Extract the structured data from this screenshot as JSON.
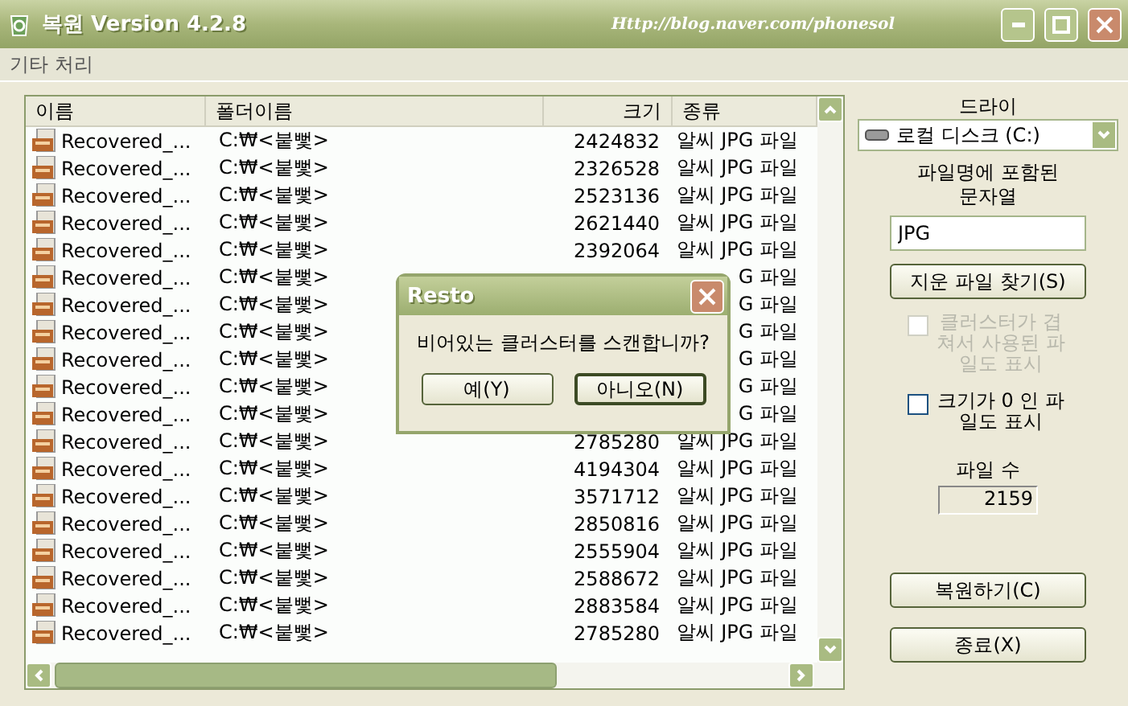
{
  "window": {
    "title": "복원 Version 4.2.8",
    "url": "Http://blog.naver.com/phonesol"
  },
  "menu": [
    "기타 처리"
  ],
  "table": {
    "columns": [
      "이름",
      "폴더이름",
      "크기",
      "종류"
    ],
    "rows": [
      {
        "name": "Recovered_...",
        "folder": "C:₩<붙뻧>",
        "size": "2424832",
        "type": "알씨 JPG 파일"
      },
      {
        "name": "Recovered_...",
        "folder": "C:₩<붙뻧>",
        "size": "2326528",
        "type": "알씨 JPG 파일"
      },
      {
        "name": "Recovered_...",
        "folder": "C:₩<붙뻧>",
        "size": "2523136",
        "type": "알씨 JPG 파일"
      },
      {
        "name": "Recovered_...",
        "folder": "C:₩<붙뻧>",
        "size": "2621440",
        "type": "알씨 JPG 파일"
      },
      {
        "name": "Recovered_...",
        "folder": "C:₩<붙뻧>",
        "size": "2392064",
        "type": "알씨 JPG 파일"
      },
      {
        "name": "Recovered_...",
        "folder": "C:₩<붙뻧>",
        "type": "G 파일"
      },
      {
        "name": "Recovered_...",
        "folder": "C:₩<붙뻧>",
        "type": "G 파일"
      },
      {
        "name": "Recovered_...",
        "folder": "C:₩<붙뻧>",
        "type": "G 파일"
      },
      {
        "name": "Recovered_...",
        "folder": "C:₩<붙뻧>",
        "type": "G 파일"
      },
      {
        "name": "Recovered_...",
        "folder": "C:₩<붙뻧>",
        "type": "G 파일"
      },
      {
        "name": "Recovered_...",
        "folder": "C:₩<붙뻧>",
        "type": "G 파일"
      },
      {
        "name": "Recovered_...",
        "folder": "C:₩<붙뻧>",
        "size": "2785280",
        "type": "알씨 JPG 파일"
      },
      {
        "name": "Recovered_...",
        "folder": "C:₩<붙뻧>",
        "size": "4194304",
        "type": "알씨 JPG 파일"
      },
      {
        "name": "Recovered_...",
        "folder": "C:₩<붙뻧>",
        "size": "3571712",
        "type": "알씨 JPG 파일"
      },
      {
        "name": "Recovered_...",
        "folder": "C:₩<붙뻧>",
        "size": "2850816",
        "type": "알씨 JPG 파일"
      },
      {
        "name": "Recovered_...",
        "folder": "C:₩<붙뻧>",
        "size": "2555904",
        "type": "알씨 JPG 파일"
      },
      {
        "name": "Recovered_...",
        "folder": "C:₩<붙뻧>",
        "size": "2588672",
        "type": "알씨 JPG 파일"
      },
      {
        "name": "Recovered_...",
        "folder": "C:₩<붙뻧>",
        "size": "2883584",
        "type": "알씨 JPG 파일"
      },
      {
        "name": "Recovered_...",
        "folder": "C:₩<붙뻧>",
        "size": "2785280",
        "type": "알씨 JPG 파일"
      }
    ]
  },
  "side": {
    "drive_label": "드라이",
    "drive_value": "로컬 디스크 (C:)",
    "filter_label": "파일명에 포함된 문자열",
    "filter_value": "JPG",
    "search_button": "지운 파일 찾기(S)",
    "options": [
      {
        "label": "클러스터가 겹쳐서 사용된 파일도 표시",
        "checked": false,
        "disabled": true
      },
      {
        "label": "크기가 0 인 파일도 표시",
        "checked": false,
        "disabled": false
      }
    ],
    "count_label": "파일 수",
    "count_value": "2159",
    "restore_button": "복원하기(C)",
    "exit_button": "종료(X)"
  },
  "dialog": {
    "title": "Resto",
    "message": "비어있는 클러스터를 스캔합니까?",
    "buttons": [
      {
        "label": "예(Y)",
        "selected": false
      },
      {
        "label": "아니오(N)",
        "selected": true
      }
    ]
  }
}
